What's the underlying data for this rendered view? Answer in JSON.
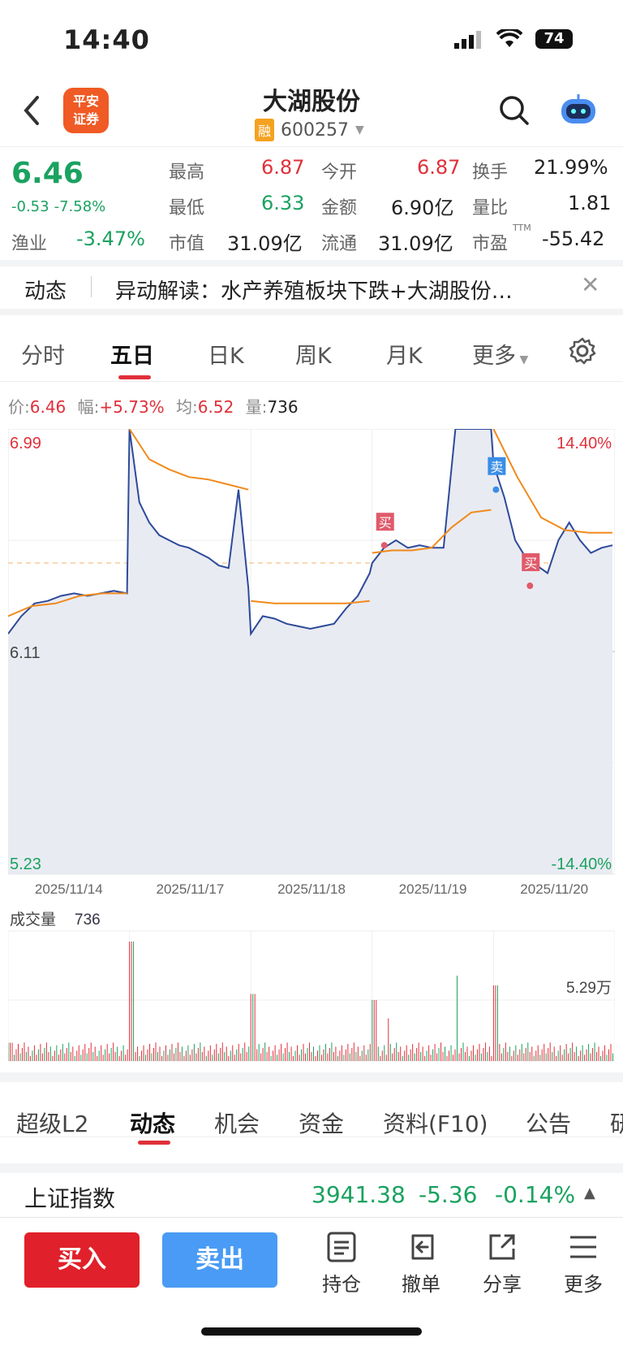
{
  "status": {
    "time": "14:40",
    "battery": "74"
  },
  "header": {
    "back_icon": "chevron-left-icon",
    "broker_logo_line1": "平安",
    "broker_logo_line2": "证券",
    "title": "大湖股份",
    "badge": "融",
    "code": "600257",
    "search_icon": "search-icon",
    "assistant_icon": "robot-icon"
  },
  "quote": {
    "price": "6.46",
    "change": "-0.53",
    "change_pct": "-7.58%",
    "high_label": "最高",
    "high": "6.87",
    "open_label": "今开",
    "open": "6.87",
    "turnover_label": "换手",
    "turnover": "21.99%",
    "low_label": "最低",
    "low": "6.33",
    "amount_label": "金额",
    "amount": "6.90亿",
    "vol_ratio_label": "量比",
    "vol_ratio": "1.81",
    "industry_label": "渔业",
    "industry_pct": "-3.47%",
    "mktcap_label": "市值",
    "mktcap": "31.09亿",
    "float_label": "流通",
    "float_cap": "31.09亿",
    "pe_label": "市盈",
    "pe_sup": "TTM",
    "pe": "-55.42"
  },
  "news": {
    "label": "动态",
    "text": "异动解读：水产养殖板块下跌+大湖股份…"
  },
  "tabs": [
    "分时",
    "五日",
    "日K",
    "周K",
    "月K",
    "更多"
  ],
  "active_tab": "五日",
  "info": {
    "price_label": "价:",
    "price": "6.46",
    "range_label": "幅:",
    "range": "+5.73%",
    "avg_label": "均:",
    "avg": "6.52",
    "vol_label": "量:",
    "vol": "736"
  },
  "chart_data": {
    "type": "line",
    "x": [
      "2025/11/14",
      "2025/11/17",
      "2025/11/18",
      "2025/11/19",
      "2025/11/20"
    ],
    "ylim": [
      5.23,
      6.99
    ],
    "y_ticks": [
      "6.99",
      "6.11",
      "5.23"
    ],
    "pct_ticks": [
      "14.40%",
      "-14.40%"
    ],
    "series": [],
    "markers": [
      {
        "label": "买",
        "day": "2025/11/19",
        "price": 6.53
      },
      {
        "label": "卖",
        "day": "2025/11/20",
        "price": 6.75
      },
      {
        "label": "买",
        "day": "2025/11/20",
        "price": 6.37
      }
    ],
    "volume": {
      "label": "成交量",
      "value": "736",
      "max_label": "5.29万"
    },
    "colors": {
      "price": "#2d4a9a",
      "avg": "#f08a1c",
      "up": "#e0303a",
      "down": "#1aa260"
    }
  },
  "bottom_tabs": [
    "超级L2",
    "动态",
    "机会",
    "资金",
    "资料(F10)",
    "公告",
    "研"
  ],
  "active_bottom_tab": "动态",
  "index": {
    "name": "上证指数",
    "value": "3941.38",
    "change": "-5.36",
    "pct": "-0.14%"
  },
  "actions": {
    "buy": "买入",
    "sell": "卖出",
    "hold": "持仓",
    "cancel": "撤单",
    "share": "分享",
    "more": "更多"
  }
}
